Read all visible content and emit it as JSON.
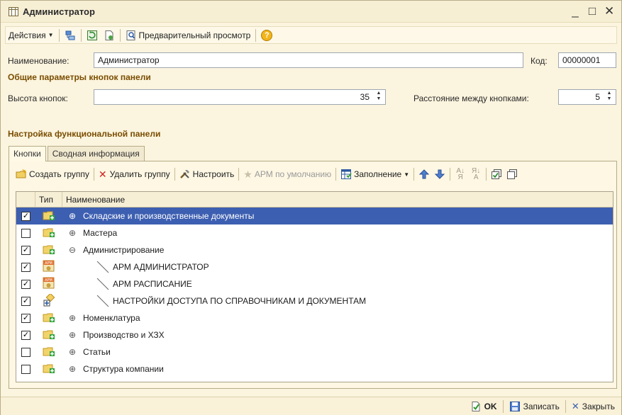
{
  "window": {
    "title": "Администратор",
    "controls": [
      "_",
      "□",
      "✕"
    ]
  },
  "toolbar": {
    "actions_label": "Действия",
    "preview_label": "Предварительный просмотр",
    "help_label": "?"
  },
  "form": {
    "name_label": "Наименование:",
    "name_value": "Администратор",
    "code_label": "Код:",
    "code_value": "00000001",
    "section_buttons": "Общие параметры кнопок панели",
    "height_label": "Высота кнопок:",
    "height_value": "35",
    "spacing_label": "Расстояние между кнопками:",
    "spacing_value": "5",
    "section_panel": "Настройка функциональной панели"
  },
  "tabs": [
    {
      "label": "Кнопки",
      "active": true
    },
    {
      "label": "Сводная информация",
      "active": false
    }
  ],
  "inner_toolbar": {
    "create_group": "Создать группу",
    "delete_group": "Удалить группу",
    "configure": "Настроить",
    "arm_default": "АРМ по умолчанию",
    "fill": "Заполнение"
  },
  "grid": {
    "col_type": "Тип",
    "col_name": "Наименование",
    "rows": [
      {
        "checked": true,
        "icon": "folder-plus-icon",
        "expander": "⊕",
        "level": 0,
        "name": "Складские и производственные документы",
        "selected": true
      },
      {
        "checked": false,
        "icon": "folder-plus-icon",
        "expander": "⊕",
        "level": 0,
        "name": "Мастера",
        "selected": false
      },
      {
        "checked": true,
        "icon": "folder-plus-icon",
        "expander": "⊖",
        "level": 0,
        "name": "Администрирование",
        "selected": false
      },
      {
        "checked": true,
        "icon": "arm-icon",
        "expander": "",
        "level": 1,
        "name": "АРМ АДМИНИСТРАТОР",
        "selected": false
      },
      {
        "checked": true,
        "icon": "arm-icon",
        "expander": "",
        "level": 1,
        "name": "АРМ РАСПИСАНИЕ",
        "selected": false
      },
      {
        "checked": true,
        "icon": "access-icon",
        "expander": "",
        "level": 1,
        "name": "НАСТРОЙКИ ДОСТУПА ПО СПРАВОЧНИКАМ И ДОКУМЕНТАМ",
        "selected": false
      },
      {
        "checked": true,
        "icon": "folder-plus-icon",
        "expander": "⊕",
        "level": 0,
        "name": "Номенклатура",
        "selected": false
      },
      {
        "checked": true,
        "icon": "folder-plus-icon",
        "expander": "⊕",
        "level": 0,
        "name": "Производство и ХЗХ",
        "selected": false
      },
      {
        "checked": false,
        "icon": "folder-plus-icon",
        "expander": "⊕",
        "level": 0,
        "name": "Статьи",
        "selected": false
      },
      {
        "checked": false,
        "icon": "folder-plus-icon",
        "expander": "⊕",
        "level": 0,
        "name": "Структура компании",
        "selected": false
      }
    ]
  },
  "bottom": {
    "ok": "OK",
    "save": "Записать",
    "close": "Закрыть"
  }
}
